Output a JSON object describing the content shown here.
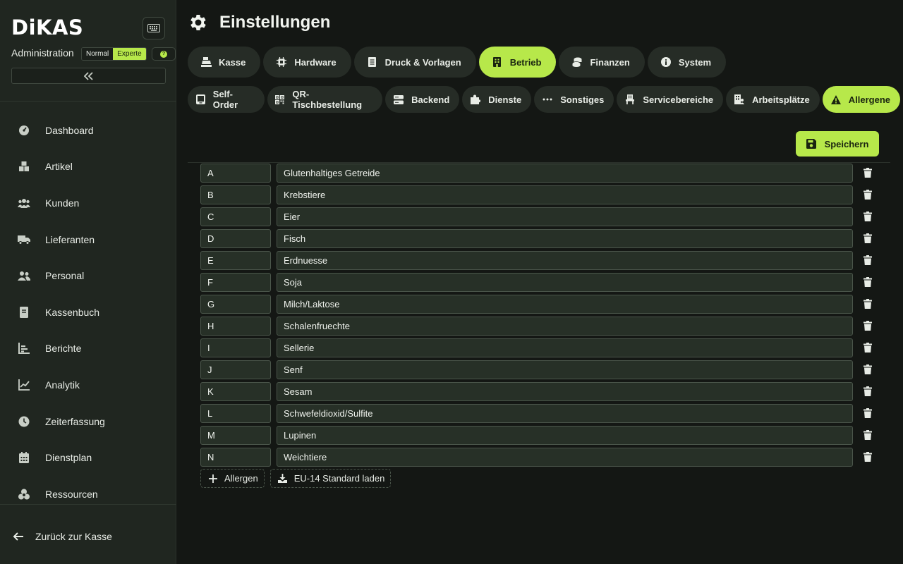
{
  "sidebar": {
    "logo": "DiKAS",
    "admin_label": "Administration",
    "modes": [
      "Normal",
      "Experte"
    ],
    "active_mode": "Experte",
    "items": [
      {
        "label": "Dashboard",
        "icon": "dashboard-icon"
      },
      {
        "label": "Artikel",
        "icon": "boxes-icon"
      },
      {
        "label": "Kunden",
        "icon": "users-icon"
      },
      {
        "label": "Lieferanten",
        "icon": "truck-icon"
      },
      {
        "label": "Personal",
        "icon": "user-group-icon"
      },
      {
        "label": "Kassenbuch",
        "icon": "book-icon"
      },
      {
        "label": "Berichte",
        "icon": "bar-chart-icon"
      },
      {
        "label": "Analytik",
        "icon": "line-chart-icon"
      },
      {
        "label": "Zeiterfassung",
        "icon": "clock-icon"
      },
      {
        "label": "Dienstplan",
        "icon": "calendar-icon"
      },
      {
        "label": "Ressourcen",
        "icon": "cubes-icon"
      }
    ],
    "back_label": "Zurück zur Kasse"
  },
  "header": {
    "title": "Einstellungen"
  },
  "tabs_main": [
    {
      "label": "Kasse",
      "icon": "cash-register-icon"
    },
    {
      "label": "Hardware",
      "icon": "chip-icon"
    },
    {
      "label": "Druck & Vorlagen",
      "icon": "document-icon"
    },
    {
      "label": "Betrieb",
      "icon": "building-icon"
    },
    {
      "label": "Finanzen",
      "icon": "coins-icon"
    },
    {
      "label": "System",
      "icon": "info-icon"
    }
  ],
  "active_main_tab": "Betrieb",
  "tabs_sub": [
    {
      "label": "Self-Order",
      "icon": "tablet-icon"
    },
    {
      "label": "QR-Tischbestellung",
      "icon": "qrcode-icon"
    },
    {
      "label": "Backend",
      "icon": "server-icon"
    },
    {
      "label": "Dienste",
      "icon": "puzzle-icon"
    },
    {
      "label": "Sonstiges",
      "icon": "ellipsis-icon"
    },
    {
      "label": "Servicebereiche",
      "icon": "chair-icon"
    },
    {
      "label": "Arbeitsplätze",
      "icon": "workplace-icon"
    },
    {
      "label": "Allergene",
      "icon": "warning-icon"
    }
  ],
  "active_sub_tab": "Allergene",
  "save_label": "Speichern",
  "allergens": [
    {
      "code": "A",
      "name": "Glutenhaltiges Getreide"
    },
    {
      "code": "B",
      "name": "Krebstiere"
    },
    {
      "code": "C",
      "name": "Eier"
    },
    {
      "code": "D",
      "name": "Fisch"
    },
    {
      "code": "E",
      "name": "Erdnuesse"
    },
    {
      "code": "F",
      "name": "Soja"
    },
    {
      "code": "G",
      "name": "Milch/Laktose"
    },
    {
      "code": "H",
      "name": "Schalenfruechte"
    },
    {
      "code": "I",
      "name": "Sellerie"
    },
    {
      "code": "J",
      "name": "Senf"
    },
    {
      "code": "K",
      "name": "Sesam"
    },
    {
      "code": "L",
      "name": "Schwefeldioxid/Sulfite"
    },
    {
      "code": "M",
      "name": "Lupinen"
    },
    {
      "code": "N",
      "name": "Weichtiere"
    }
  ],
  "add_label": "Allergen",
  "load_standard_label": "EU-14 Standard laden",
  "colors": {
    "accent": "#b7e84a",
    "sidebar_bg": "#202620",
    "main_bg": "#141714",
    "tab_bg": "#262c26",
    "input_bg": "#273027"
  }
}
